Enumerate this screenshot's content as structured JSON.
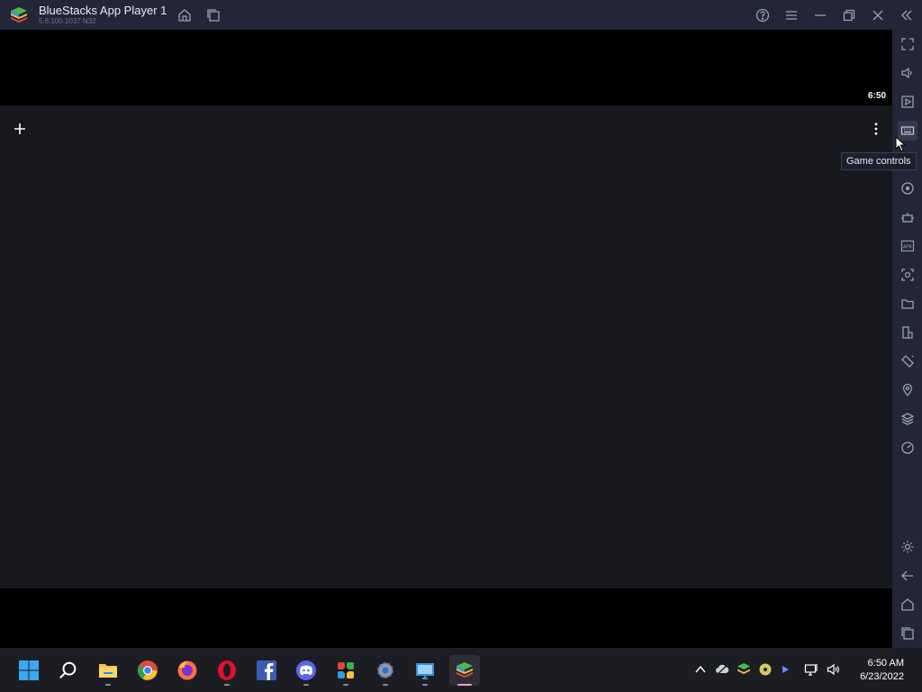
{
  "window": {
    "title": "BlueStacks App Player 1",
    "version": "5.8.100.1037 N32"
  },
  "titlebar_buttons": [
    "home-icon",
    "multi-instance-icon",
    "help-icon",
    "menu-icon",
    "minimize-icon",
    "restore-icon",
    "close-icon",
    "collapse-sidebar-icon"
  ],
  "android": {
    "clock": "6:50"
  },
  "sidebar": {
    "items": [
      "fullscreen",
      "volume",
      "media",
      "keyboard",
      "rotate",
      "macro",
      "install-apk",
      "screenshot",
      "media-folder",
      "multi-instance",
      "shake",
      "location",
      "eco-mode",
      "performance",
      "settings",
      "back",
      "home",
      "recent-apps"
    ],
    "tooltip": "Game controls"
  },
  "taskbar": {
    "apps": [
      "start",
      "search",
      "file-explorer",
      "chrome",
      "firefox",
      "opera",
      "facebook",
      "discord",
      "app-cluster",
      "settings",
      "remote-desktop",
      "bluestacks"
    ]
  },
  "tray": {
    "time": "6:50 AM",
    "date": "6/23/2022"
  },
  "colors": {
    "titlebar": "#232637",
    "launcher_bg": "#16181d",
    "taskbar": "#1c1d22",
    "active_indicator": "#f29ad0"
  }
}
